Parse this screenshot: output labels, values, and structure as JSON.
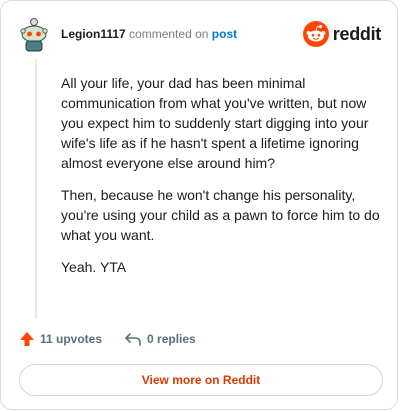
{
  "comment": {
    "username": "Legion1117",
    "action_text": "commented on",
    "post_link": "post",
    "body": [
      "All your life, your dad has been minimal communication from what you've written, but now you expect him to suddenly start digging into your wife's life as if he hasn't spent a lifetime ignoring almost everyone else around him?",
      "Then, because he won't change his personality, you're using your child as a pawn to force him to do what you want.",
      "Yeah. YTA"
    ],
    "upvotes": "11 upvotes",
    "replies": "0 replies"
  },
  "brand": {
    "wordmark": "reddit",
    "color": "#ff4500"
  },
  "footer": {
    "view_more": "View more on Reddit"
  },
  "icons": {
    "avatar": "snoo-avatar-icon",
    "logo": "reddit-logo-icon",
    "upvote": "upvote-arrow-icon",
    "reply": "reply-arrow-icon"
  },
  "colors": {
    "upvote": "#ff4500",
    "link": "#0079d3",
    "view_more": "#d93a00"
  }
}
